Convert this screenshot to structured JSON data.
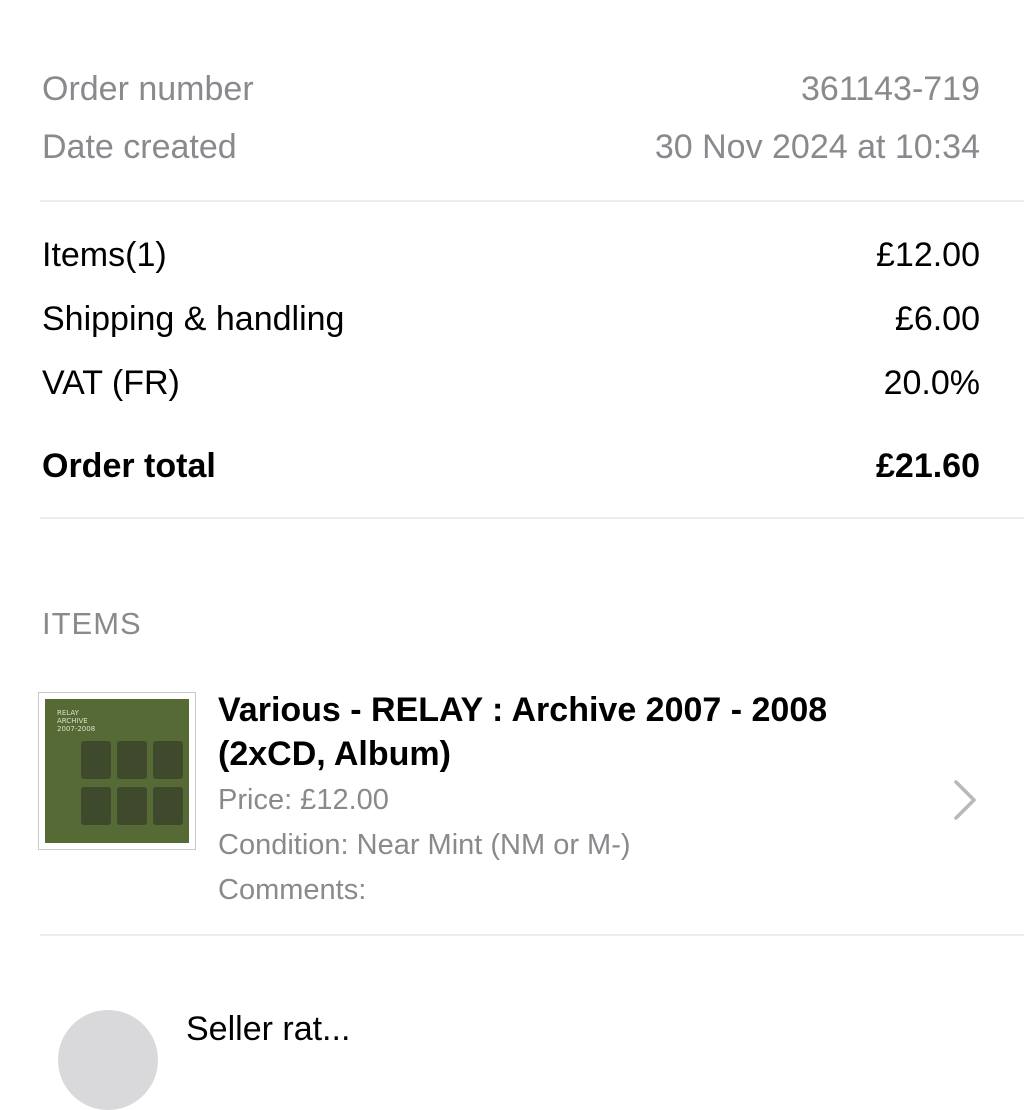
{
  "order": {
    "number_label": "Order number",
    "number_value": "361143-719",
    "date_label": "Date created",
    "date_value": "30 Nov 2024 at 10:34"
  },
  "summary": {
    "items_label": "Items(1)",
    "items_value": "£12.00",
    "shipping_label": "Shipping & handling",
    "shipping_value": "£6.00",
    "vat_label": "VAT (FR)",
    "vat_value": "20.0%",
    "total_label": "Order total",
    "total_value": "£21.60"
  },
  "items_section": {
    "header": "ITEMS",
    "items": [
      {
        "title": "Various - RELAY : Archive 2007 - 2008 (2xCD, Album)",
        "price": "Price: £12.00",
        "condition": "Condition: Near Mint (NM or M-)",
        "comments": "Comments:",
        "cover_text": [
          "RELAY",
          "ARCHIVE",
          "2007-2008"
        ],
        "chevron_icon": "chevron-right-icon"
      }
    ]
  },
  "seller": {
    "label": "Seller rat..."
  },
  "colors": {
    "secondary_text": "#8a8a8e",
    "divider": "#ececef",
    "cover_green": "#566a36"
  }
}
